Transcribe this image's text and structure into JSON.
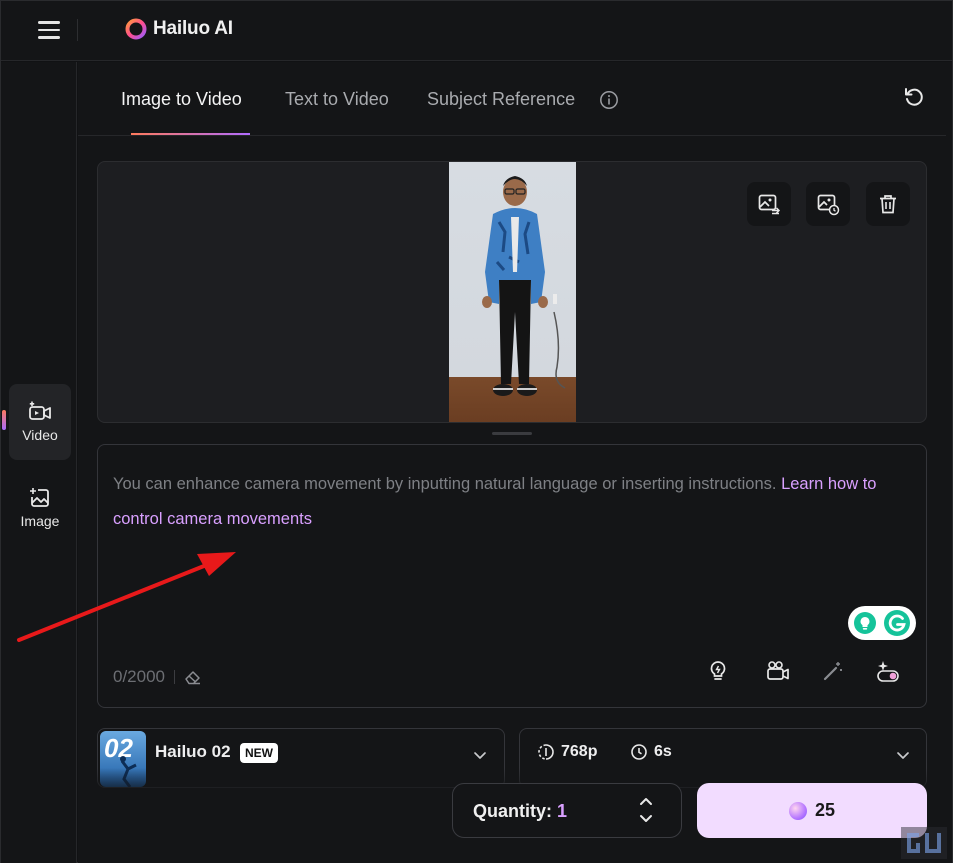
{
  "app": {
    "name": "Hailuo AI"
  },
  "sidebar": {
    "items": [
      {
        "label": "Video",
        "icon": "video-plus-icon"
      },
      {
        "label": "Image",
        "icon": "image-plus-icon"
      }
    ]
  },
  "tabs": [
    {
      "label": "Image to Video",
      "active": true
    },
    {
      "label": "Text to Video",
      "active": false
    },
    {
      "label": "Subject Reference",
      "active": false
    }
  ],
  "prompt": {
    "placeholder": "You can enhance camera movement by inputting natural language or inserting instructions.",
    "link": "Learn how to control camera movements",
    "counter": "0/2000"
  },
  "model": {
    "thumb_text": "02",
    "name": "Hailuo 02",
    "badge": "NEW"
  },
  "settings": {
    "resolution": "768p",
    "duration": "6s"
  },
  "quantity": {
    "label": "Quantity:",
    "value": "1"
  },
  "generate": {
    "credits": "25"
  },
  "colors": {
    "accent_link": "#d9a0ff",
    "generate_bg": "#f2dcff",
    "annotation_arrow": "#e8191a",
    "background": "#141517"
  }
}
